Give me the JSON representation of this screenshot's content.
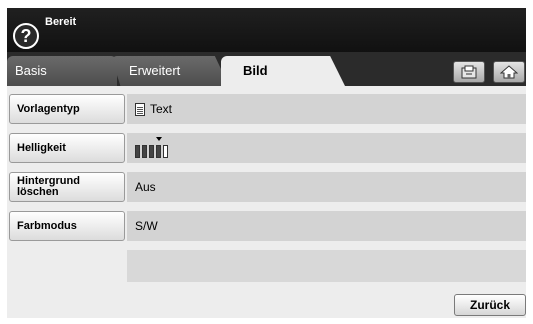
{
  "status": {
    "text": "Bereit",
    "help_icon": "help-icon"
  },
  "tabs": [
    {
      "label": "Basis",
      "active": false
    },
    {
      "label": "Erweitert",
      "active": false
    },
    {
      "label": "Bild",
      "active": true
    }
  ],
  "toolbar": {
    "copy_icon": "copy-icon",
    "home_icon": "home-icon"
  },
  "rows": [
    {
      "label": "Vorlagentyp",
      "value": "Text",
      "icon": "document-icon"
    },
    {
      "label": "Helligkeit",
      "value": "",
      "level": 4,
      "levels": 5
    },
    {
      "label": "Hintergrund löschen",
      "value": "Aus"
    },
    {
      "label": "Farbmodus",
      "value": "S/W"
    }
  ],
  "footer": {
    "back_label": "Zurück"
  },
  "colors": {
    "header": "#1a1a1a",
    "row_value": "#d3d3d3",
    "screen": "#ededed"
  }
}
